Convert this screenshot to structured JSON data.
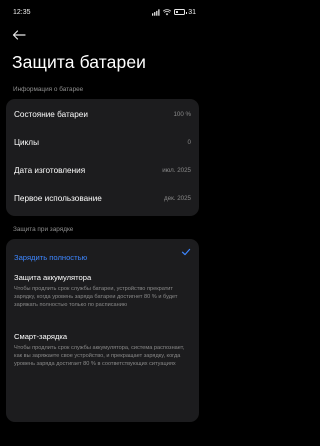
{
  "status_bar": {
    "time": "12:35",
    "battery_text": "31",
    "battery_level_percent": 31
  },
  "header": {
    "title": "Защита батареи"
  },
  "battery_info": {
    "section_label": "Информация о батарее",
    "rows": [
      {
        "label": "Состояние батареи",
        "value": "100 %"
      },
      {
        "label": "Циклы",
        "value": "0"
      },
      {
        "label": "Дата изготовления",
        "value": "июл. 2025"
      },
      {
        "label": "Первое использование",
        "value": "дек. 2025"
      }
    ]
  },
  "charging": {
    "section_label": "Защита при зарядке",
    "selected_option": "Зарядить полностью",
    "options": [
      {
        "title": "Защита аккумулятора",
        "description": "Чтобы продлить срок службы батареи, устройство прекратит зарядку, когда уровень заряда батареи достигнет 80 % и будет заряжать полностью только по расписанию"
      },
      {
        "title": "Смарт-зарядка",
        "description": "Чтобы продлить срок службы аккумулятора, система распознает, как вы заряжаете свое устройство, и прекращает зарядку, когда уровень заряда достигает 80 % в соответствующих ситуациях"
      }
    ]
  },
  "colors": {
    "background": "#000000",
    "card": "#1c1c1e",
    "accent": "#3d86ff",
    "secondary_text": "#8a8a8a"
  }
}
